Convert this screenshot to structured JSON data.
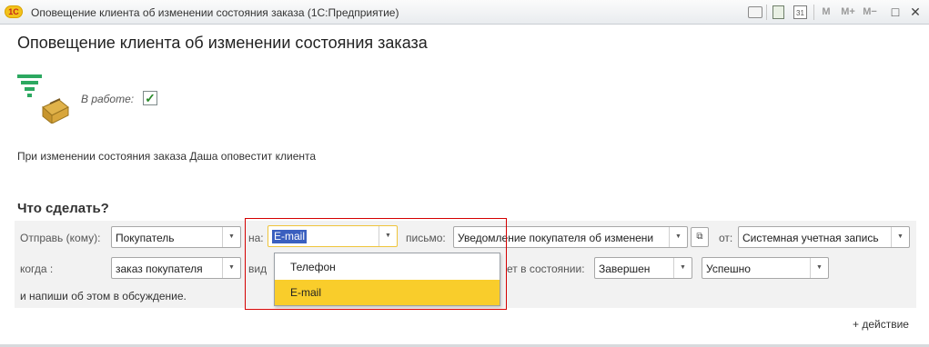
{
  "window": {
    "title": "Оповещение клиента об изменении состояния заказа  (1С:Предприятие)",
    "logo": "1C",
    "toolbar": {
      "print_icon": "printer-icon",
      "calc_icon": "calculator-icon",
      "calendar_icon": "calendar-icon",
      "calendar_day": "31",
      "m_label": "M",
      "m_plus_label": "M+",
      "m_minus_label": "M−",
      "minimize_glyph": "□",
      "close_glyph": "✕"
    }
  },
  "form": {
    "title": "Оповещение клиента об изменении состояния заказа",
    "in_work_label": "В работе:",
    "in_work_checked": true,
    "description": "При изменении состояния заказа Даша оповестит клиента",
    "section_title": "Что сделать?",
    "row1": {
      "send_label": "Отправь (кому):",
      "recipient_value": "Покупатель",
      "channel_label": "на:",
      "channel_value": "E-mail",
      "letter_label": "письмо:",
      "letter_value": "Уведомление покупателя об изменени",
      "from_label": "от:",
      "from_value": "Системная учетная запись"
    },
    "row2": {
      "when_label": "когда :",
      "doc_value": "заказ покупателя",
      "type_label_partial": "вид",
      "state_label_partial": "ет в состоянии:",
      "state_value": "Завершен",
      "result_value": "Успешно"
    },
    "note": "и напиши об этом в обсуждение.",
    "channel_options": [
      "Телефон",
      "E-mail"
    ],
    "channel_selected_index": 1,
    "add_action_label": "+ действие"
  },
  "colors": {
    "highlight_frame": "#d40000",
    "selected_option": "#f9cd2b",
    "text_selection": "#3a5fbf"
  }
}
